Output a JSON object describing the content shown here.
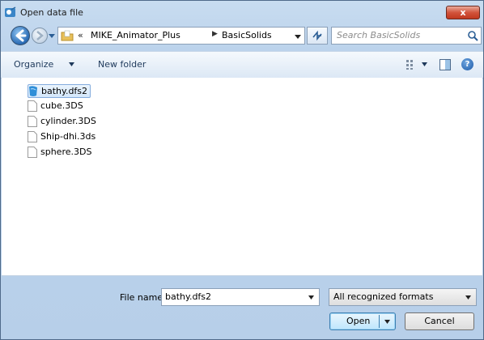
{
  "window": {
    "title": "Open data file",
    "close_label": "x"
  },
  "nav": {
    "breadcrumb_prefix": "«",
    "breadcrumb": [
      "MIKE_Animator_Plus",
      "BasicSolids"
    ],
    "search_placeholder": "Search BasicSolids"
  },
  "toolbar": {
    "organize_label": "Organize",
    "new_folder_label": "New folder",
    "help_label": "?"
  },
  "files": [
    {
      "name": "bathy.dfs2",
      "selected": true,
      "icon": "data-file-icon"
    },
    {
      "name": "cube.3DS",
      "selected": false,
      "icon": "blank-file-icon"
    },
    {
      "name": "cylinder.3DS",
      "selected": false,
      "icon": "blank-file-icon"
    },
    {
      "name": "Ship-dhi.3ds",
      "selected": false,
      "icon": "blank-file-icon"
    },
    {
      "name": "sphere.3DS",
      "selected": false,
      "icon": "blank-file-icon"
    }
  ],
  "footer": {
    "file_name_label": "File name:",
    "file_name_value": "bathy.dfs2",
    "filter_value": "All recognized formats",
    "open_label": "Open",
    "cancel_label": "Cancel"
  },
  "colors": {
    "window_frame": "#bcd3ec",
    "close_button": "#c0381f",
    "selection": "#d3e7fb",
    "link_text": "#1e395b"
  }
}
